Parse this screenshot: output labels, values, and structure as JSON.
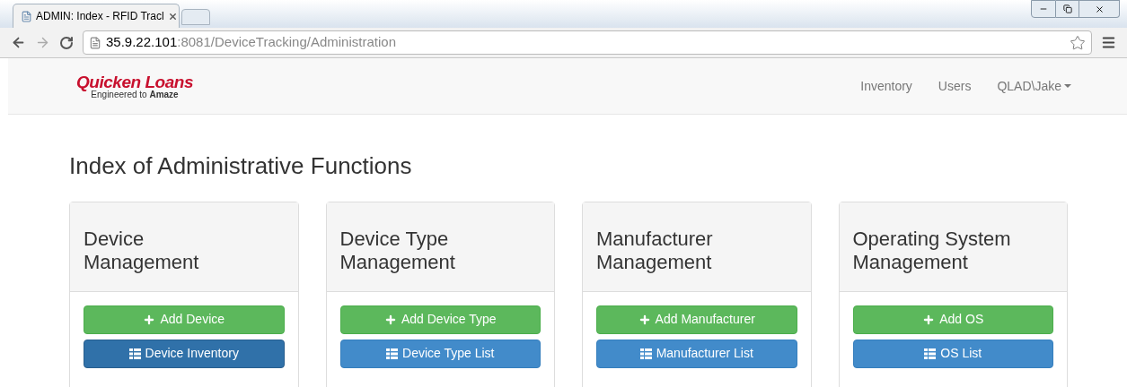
{
  "browser": {
    "tab_title": "ADMIN: Index - RFID Tracl",
    "url_host": "35.9.22.101",
    "url_path": ":8081/DeviceTracking/Administration"
  },
  "navbar": {
    "logo": {
      "name": "Quicken Loans",
      "tagline": "Engineered to **Amaze**"
    },
    "links": [
      {
        "label": "Inventory",
        "dropdown": false
      },
      {
        "label": "Users",
        "dropdown": false
      },
      {
        "label": "QLAD\\Jake",
        "dropdown": true
      }
    ]
  },
  "heading": "Index of Administrative Functions",
  "cards": [
    {
      "title": "Device Management",
      "buttons": [
        {
          "kind": "add",
          "label": "Add Device",
          "selected": false
        },
        {
          "kind": "list",
          "label": "Device Inventory",
          "selected": true
        }
      ]
    },
    {
      "title": "Device Type Management",
      "buttons": [
        {
          "kind": "add",
          "label": "Add Device Type",
          "selected": false
        },
        {
          "kind": "list",
          "label": "Device Type List",
          "selected": false
        }
      ]
    },
    {
      "title": "Manufacturer Management",
      "buttons": [
        {
          "kind": "add",
          "label": "Add Manufacturer",
          "selected": false
        },
        {
          "kind": "list",
          "label": "Manufacturer List",
          "selected": false
        }
      ]
    },
    {
      "title": "Operating System Management",
      "buttons": [
        {
          "kind": "add",
          "label": "Add OS",
          "selected": false
        },
        {
          "kind": "list",
          "label": "OS List",
          "selected": false
        }
      ]
    }
  ]
}
